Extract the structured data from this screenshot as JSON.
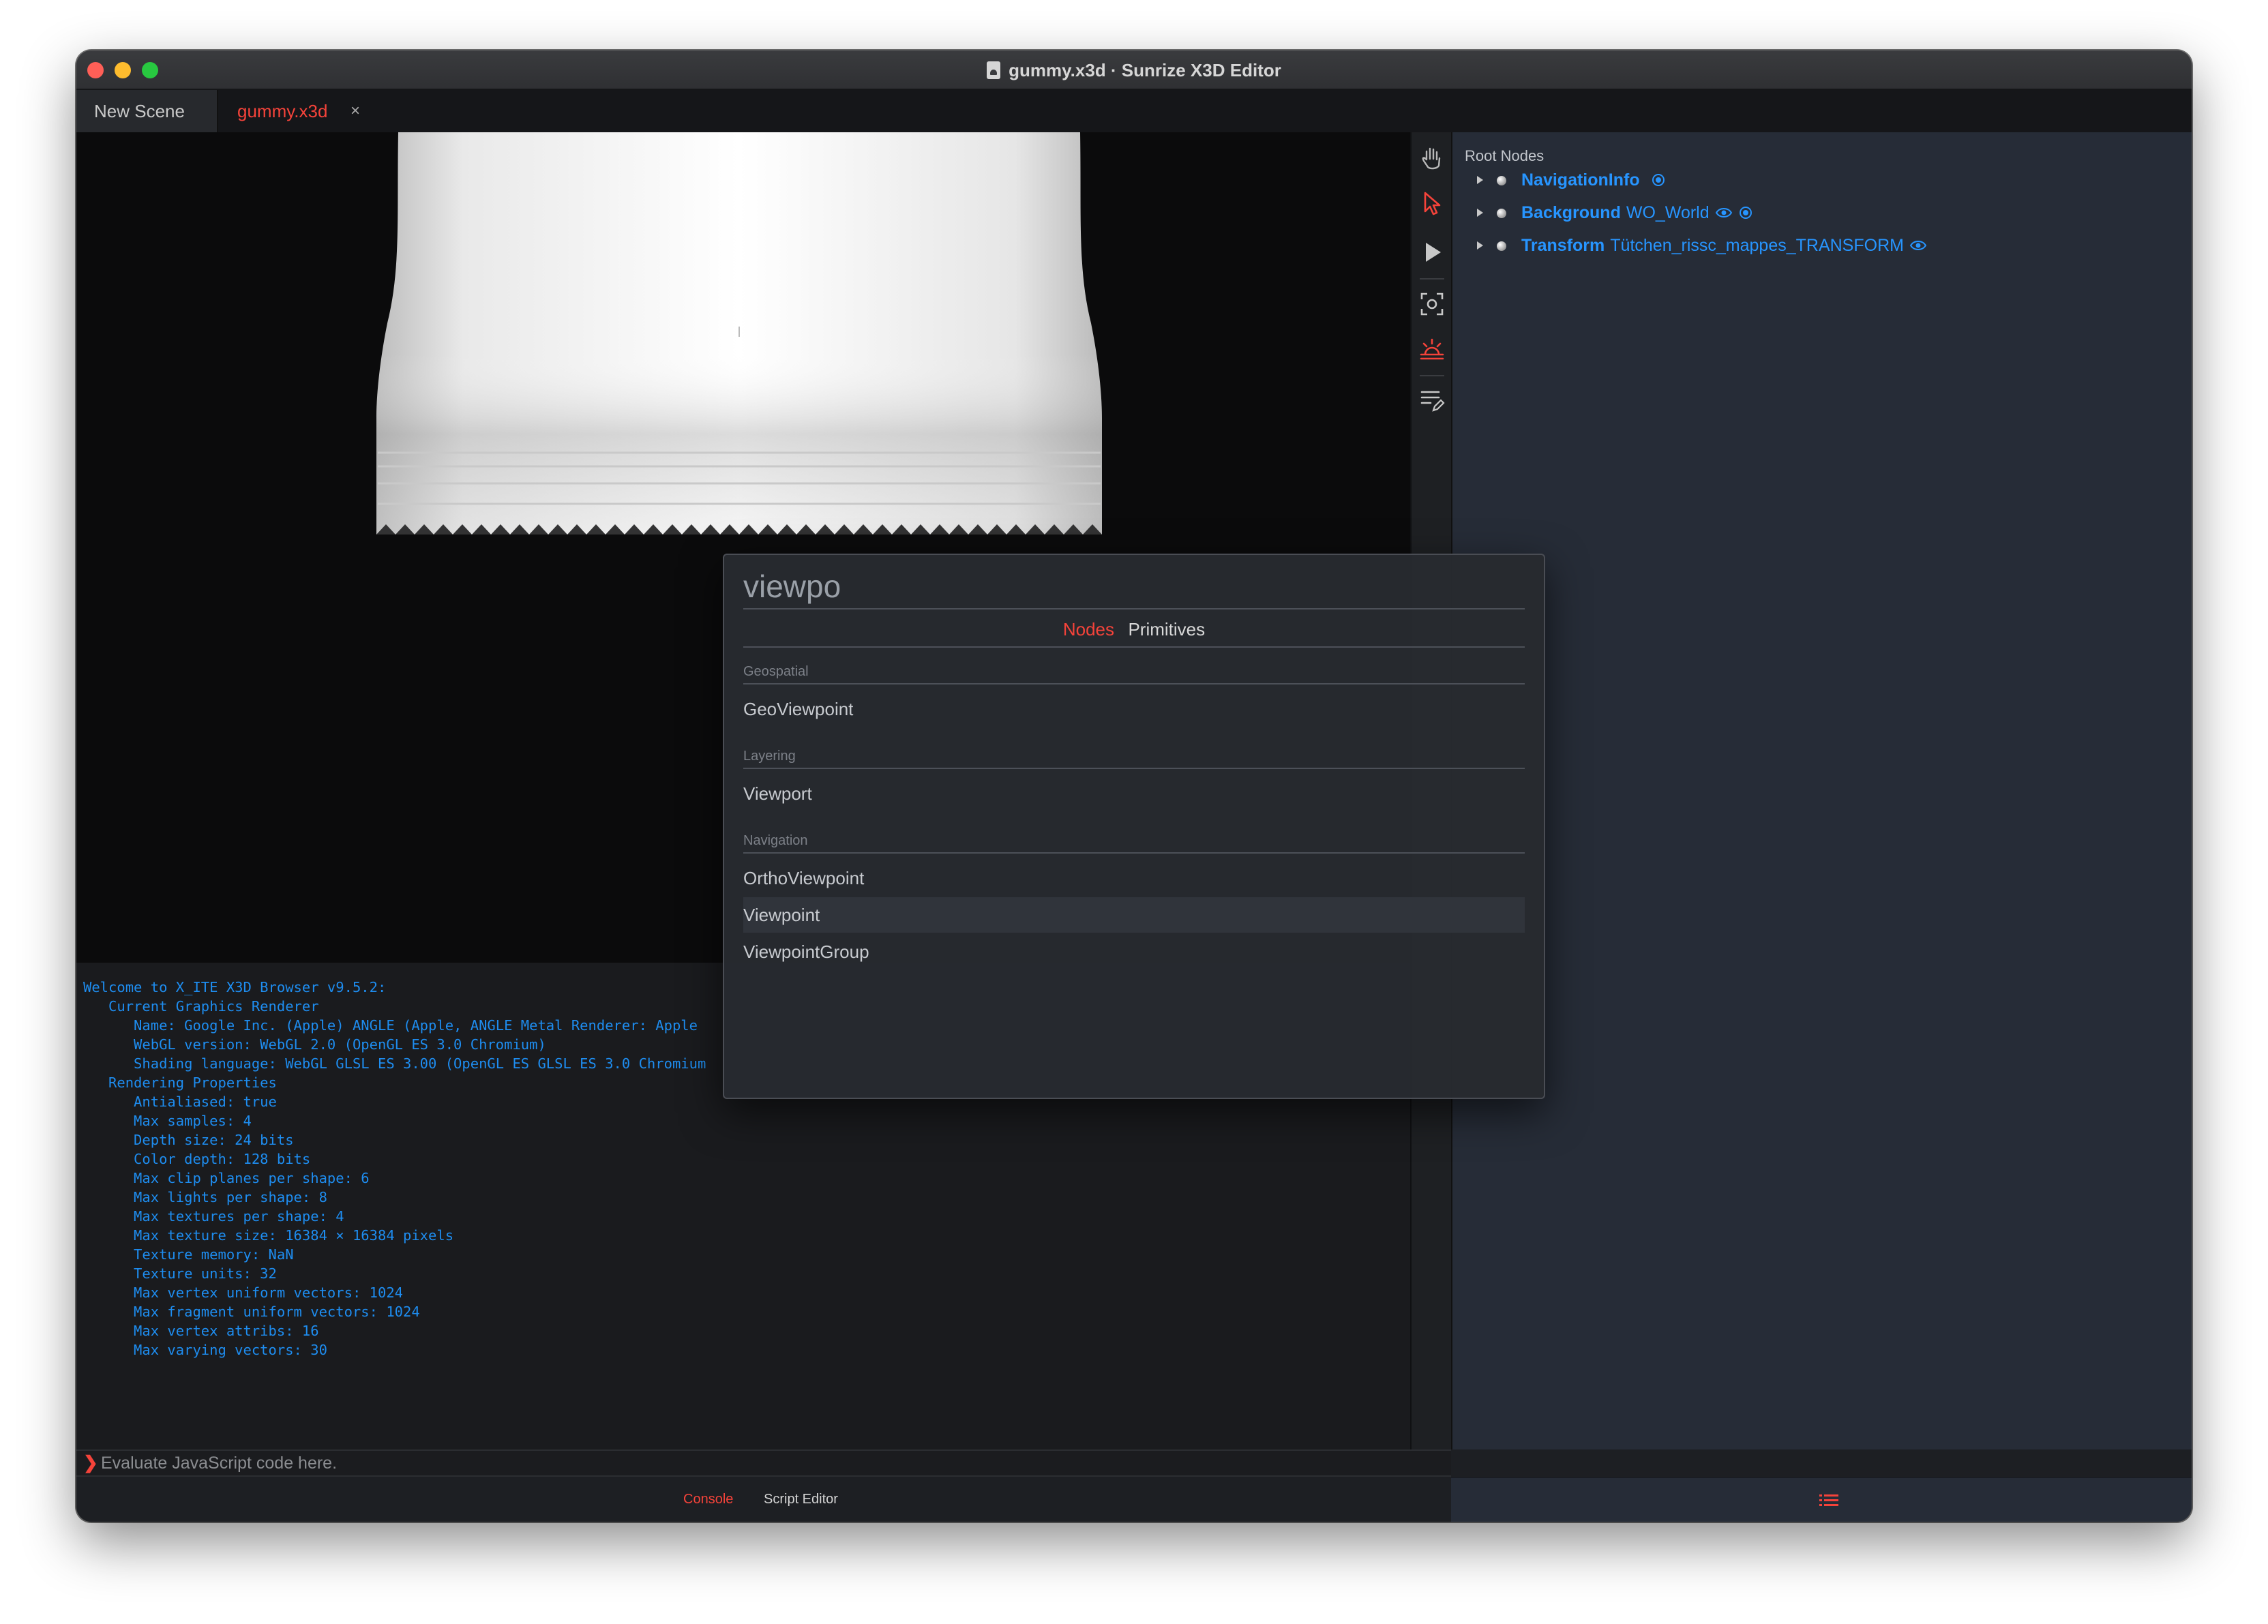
{
  "window": {
    "title": "gummy.x3d · Sunrize X3D Editor"
  },
  "tabs": [
    {
      "label": "New Scene"
    },
    {
      "label": "gummy.x3d",
      "close": "×"
    }
  ],
  "console": {
    "lines": [
      "Welcome to X_ITE X3D Browser v9.5.2:",
      "   Current Graphics Renderer",
      "      Name: Google Inc. (Apple) ANGLE (Apple, ANGLE Metal Renderer: Apple",
      "      WebGL version: WebGL 2.0 (OpenGL ES 3.0 Chromium)",
      "      Shading language: WebGL GLSL ES 3.00 (OpenGL ES GLSL ES 3.0 Chromium",
      "   Rendering Properties",
      "      Antialiased: true",
      "      Max samples: 4",
      "      Depth size: 24 bits",
      "      Color depth: 128 bits",
      "      Max clip planes per shape: 6",
      "      Max lights per shape: 8",
      "      Max textures per shape: 4",
      "      Max texture size: 16384 × 16384 pixels",
      "      Texture memory: NaN",
      "      Texture units: 32",
      "      Max vertex uniform vectors: 1024",
      "      Max fragment uniform vectors: 1024",
      "      Max vertex attribs: 16",
      "      Max varying vectors: 30"
    ],
    "input_placeholder": "Evaluate JavaScript code here.",
    "prompt_symbol": "❯"
  },
  "bottom_tabs": {
    "console": "Console",
    "script_editor": "Script Editor"
  },
  "toolbar": {
    "icons": [
      "hand-icon",
      "pointer-icon",
      "play-icon",
      "focus-icon",
      "sunrise-icon",
      "edit-list-icon"
    ]
  },
  "outline": {
    "heading": "Root Nodes",
    "nodes": [
      {
        "type": "NavigationInfo",
        "name": ""
      },
      {
        "type": "Background",
        "name": "WO_World"
      },
      {
        "type": "Transform",
        "name": "Tütchen_rissc_mappes_TRANSFORM"
      }
    ]
  },
  "popup": {
    "search_value": "viewpo",
    "tabs": [
      {
        "label": "Nodes",
        "active": true
      },
      {
        "label": "Primitives",
        "active": false
      }
    ],
    "sections": [
      {
        "title": "Geospatial",
        "items": [
          "GeoViewpoint"
        ]
      },
      {
        "title": "Layering",
        "items": [
          "Viewport"
        ]
      },
      {
        "title": "Navigation",
        "items": [
          "OrthoViewpoint",
          "Viewpoint",
          "ViewpointGroup"
        ]
      }
    ],
    "highlighted_item": "Viewpoint"
  },
  "colors": {
    "accent_red": "#f5433a",
    "link_blue": "#2795ff",
    "console_blue": "#1e8df0",
    "panel_bg": "#262c37"
  }
}
